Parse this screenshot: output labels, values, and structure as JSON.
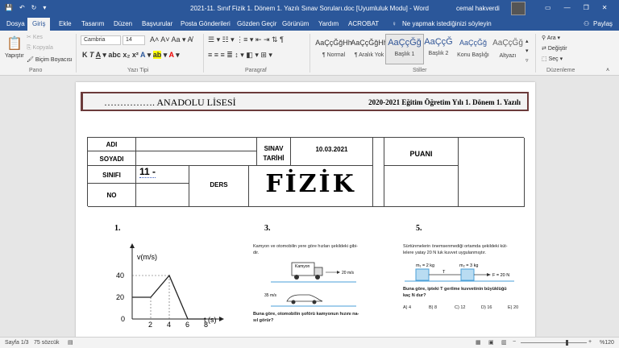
{
  "window": {
    "title": "2021-11. Sınıf Fizik 1. Dönem 1. Yazılı Sınav Soruları.doc [Uyumluluk Modu] - Word",
    "user": "cemal hakverdi"
  },
  "tabs": [
    "Dosya",
    "Giriş",
    "Ekle",
    "Tasarım",
    "Düzen",
    "Başvurular",
    "Posta Gönderileri",
    "Gözden Geçir",
    "Görünüm",
    "Yardım",
    "ACROBAT"
  ],
  "tell_me": "Ne yapmak istediğinizi söyleyin",
  "share": "Paylaş",
  "clipboard": {
    "paste": "Yapıştır",
    "cut": "Kes",
    "copy": "Kopyala",
    "painter": "Biçim Boyacısı",
    "label": "Pano"
  },
  "font": {
    "name": "Cambria",
    "size": "14",
    "label": "Yazı Tipi"
  },
  "paragraph": {
    "label": "Paragraf"
  },
  "styles": {
    "label": "Stiller",
    "items": [
      {
        "sample": "AaÇçĞğHh",
        "name": "¶ Normal"
      },
      {
        "sample": "AaÇçĞğHh",
        "name": "¶ Aralık Yok"
      },
      {
        "sample": "AaÇçĞğ",
        "name": "Başlık 1"
      },
      {
        "sample": "AaÇçĞ",
        "name": "Başlık 2"
      },
      {
        "sample": "AaÇçĞğ",
        "name": "Konu Başlığı"
      },
      {
        "sample": "AaÇçĞğ",
        "name": "Altyazı"
      }
    ]
  },
  "editing": {
    "find": "Ara",
    "replace": "Değiştir",
    "select": "Seç",
    "label": "Düzenleme"
  },
  "doc": {
    "banner_left": "……………. ANADOLU LİSESİ",
    "banner_right": "2020-2021 Eğitim Öğretim Yılı 1. Dönem 1. Yazılı",
    "adi": "ADI",
    "soyadi": "SOYADI",
    "sinav": "SINAV",
    "tarihi": "TARİHİ",
    "date": "10.03.2021",
    "puani": "PUANI",
    "sinifi": "SINIFI",
    "sinif_val": "11 -",
    "ders": "DERS",
    "no": "NO",
    "subject": "FİZİK",
    "q1": "1.",
    "q3": "3.",
    "q5": "5.",
    "q3_text1": "Kamyon ve otomobilin yere göre hızları şekildeki gibi-",
    "q3_text2": "dir.",
    "kamyon": "Kamyon",
    "v20": "20 m/s",
    "v35": "35 m/s",
    "q3_question1": "Buna göre, otomobilin şoförü kamyonun hızını na-",
    "q3_question2": "sıl görür?",
    "q5_text1": "Sürtünmelerin önemsenmediği ortamda şekildeki küt-",
    "q5_text2": "lelere yatay 20 N luk kuvvet uygulanmıştır.",
    "m1": "m₁ = 2 kg",
    "m2": "m₂ = 3 kg",
    "T": "T",
    "F": "F = 20 N",
    "q5_question1": "Buna göre, ipteki T gerilme kuvvetinin büyüklüğü",
    "q5_question2": "kaç N dur?",
    "options": [
      "A) 4",
      "B) 8",
      "C) 12",
      "D) 16",
      "E) 20"
    ]
  },
  "chart_data": {
    "type": "line",
    "ylabel": "v(m/s)",
    "xlabel": "t (s)",
    "x": [
      0,
      2,
      4,
      6,
      8
    ],
    "y": [
      20,
      20,
      40,
      0,
      0
    ],
    "xticks": [
      "2",
      "4",
      "6",
      "8"
    ],
    "yticks": [
      "0",
      "20",
      "40"
    ]
  },
  "status": {
    "page": "Sayfa 1/3",
    "words": "75 sözcük",
    "zoom": "%120"
  }
}
